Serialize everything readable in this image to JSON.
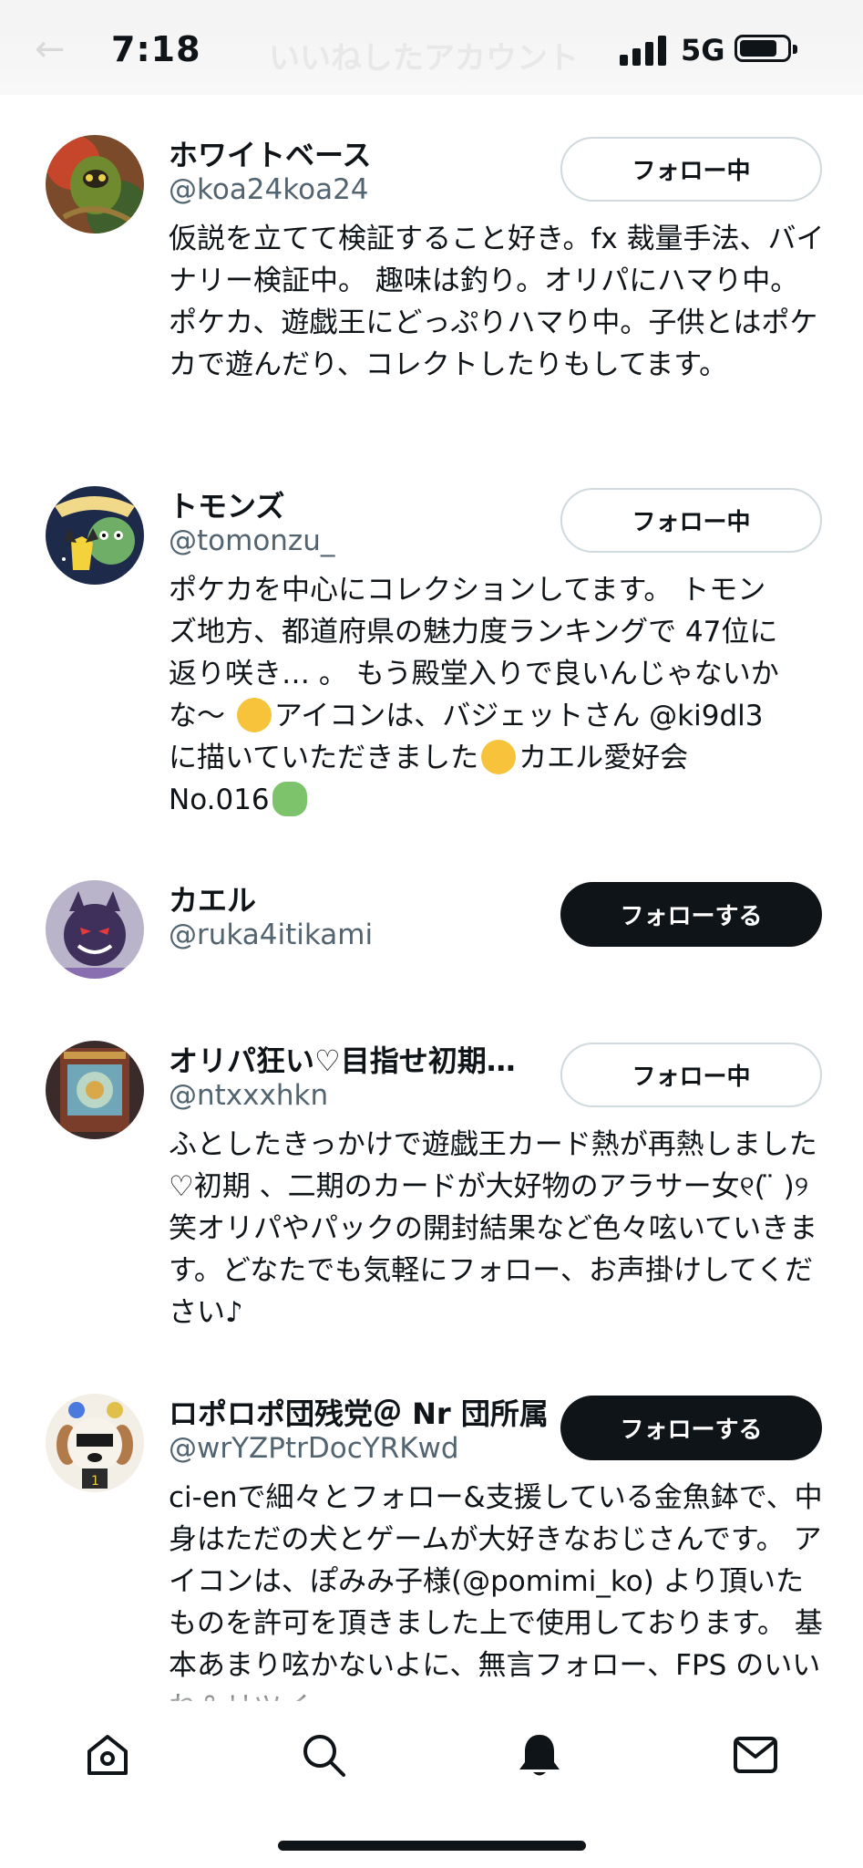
{
  "status_bar": {
    "time": "7:18",
    "network": "5G",
    "battery_level": 0.8
  },
  "header": {
    "title": "いいねしたアカウント"
  },
  "users": [
    {
      "name": "ホワイトベース",
      "handle": "@koa24koa24",
      "button": "フォロー中",
      "following": true,
      "avatar_icon": "avatar-green-monster",
      "bio": "仮説を立てて検証すること好き。fx 裁量手法、バイナリー検証中。 趣味は釣り。オリパにハマり中。ポケカ、遊戯王にどっぷりハマり中。子供とはポケカで遊んだり、コレクトしたりもしてます。"
    },
    {
      "name": "トモンズ",
      "handle": "@tomonzu_",
      "button": "フォロー中",
      "following": true,
      "avatar_icon": "avatar-pichu-frog",
      "bio_lines": [
        "ポケカを中心にコレクションしてます。 トモン",
        "ズ地方、都道府県の魅力度ランキングで 47位に",
        "返り咲き… 。 もう殿堂入りで良いんじゃないか",
        "な〜",
        "アイコンは、バジェットさん @ki9dl3",
        "に描いていただきました",
        "カエル愛好会",
        "No.016"
      ],
      "emoji": [
        "rolling-laugh-emoji",
        "smiling-emoji",
        "frog-emoji"
      ]
    },
    {
      "name": "カエル",
      "handle": "@ruka4itikami",
      "button": "フォローする",
      "following": false,
      "avatar_icon": "avatar-gengar"
    },
    {
      "name": "オリパ狂い♡目指せ初期…",
      "handle": "@ntxxxhkn",
      "button": "フォロー中",
      "following": true,
      "avatar_icon": "avatar-yugioh-card",
      "bio": "ふとしたきっかけで遊戯王カード熱が再熱しました♡初期 、二期のカードが大好物のアラサー女୧( ̈ )୨ 笑オリパやパックの開封結果など色々呟いていきます。どなたでも気軽にフォロー、お声掛けしてください♪"
    },
    {
      "name": "ロポロポ団残党＠ Nr 団所属",
      "handle": "@wrYZPtrDocYRKwd",
      "button": "フォローする",
      "following": false,
      "avatar_icon": "avatar-dog-sunglasses",
      "bio": "ci-enで細々とフォロー&支援している金魚鉢で、中身はただの犬とゲームが大好きなおじさんです。 アイコンは、ぽみみ子様(@pomimi_ko) より頂いたものを許可を頂きました上で使用しております。 基本あまり呟かないよに、無言フォロー、FPS のいいね＆リツイ"
    }
  ],
  "bottom_nav": [
    {
      "icon": "home-icon"
    },
    {
      "icon": "search-icon"
    },
    {
      "icon": "notifications-bell-icon"
    },
    {
      "icon": "messages-mail-icon"
    }
  ]
}
